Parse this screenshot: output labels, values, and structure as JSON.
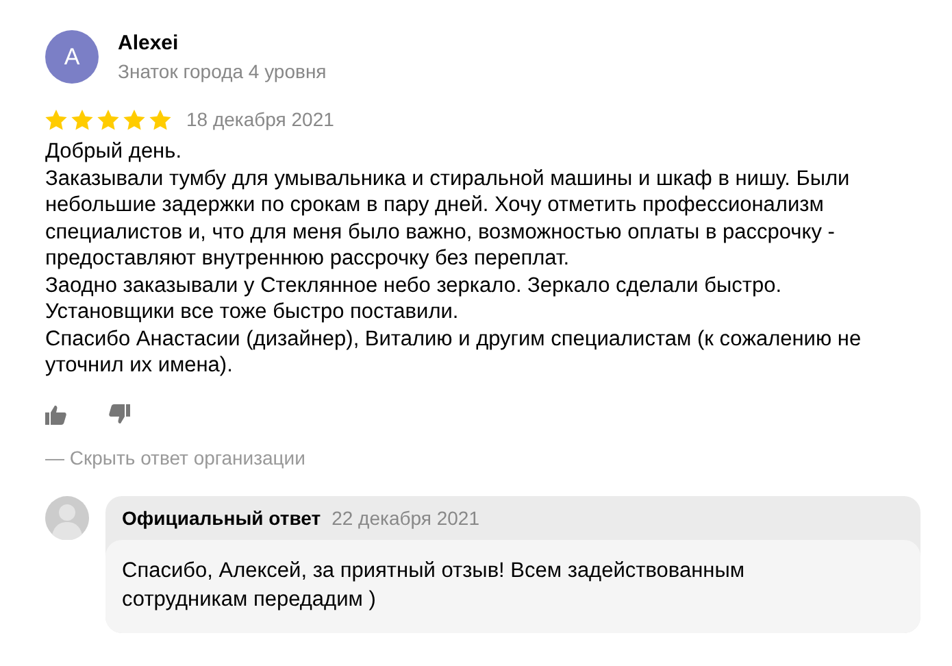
{
  "review": {
    "author": {
      "initial": "A",
      "name": "Alexei",
      "badge": "Знаток города 4 уровня"
    },
    "stars": 5,
    "date": "18 декабря 2021",
    "body_lines": [
      "Добрый день.",
      "Заказывали тумбу для умывальника и стиральной машины и шкаф в нишу. Были",
      "небольшие задержки по срокам в пару дней. Хочу отметить профессионализм",
      "специалистов и, что для меня было важно, возможностью оплаты в рассрочку -",
      "предоставляют внутреннюю рассрочку без переплат.",
      "Заодно заказывали у Стеклянное небо зеркало. Зеркало сделали быстро.",
      "Установщики все тоже быстро поставили.",
      "Спасибо Анастасии (дизайнер), Виталию и другим специалистам (к сожалению не",
      "уточнил их имена)."
    ],
    "toggle_reply": "— Скрыть ответ организации"
  },
  "reply": {
    "title": "Официальный ответ",
    "date": "22 декабря 2021",
    "text": "Спасибо, Алексей, за приятный отзыв! Всем задействованным сотрудникам передадим )"
  }
}
